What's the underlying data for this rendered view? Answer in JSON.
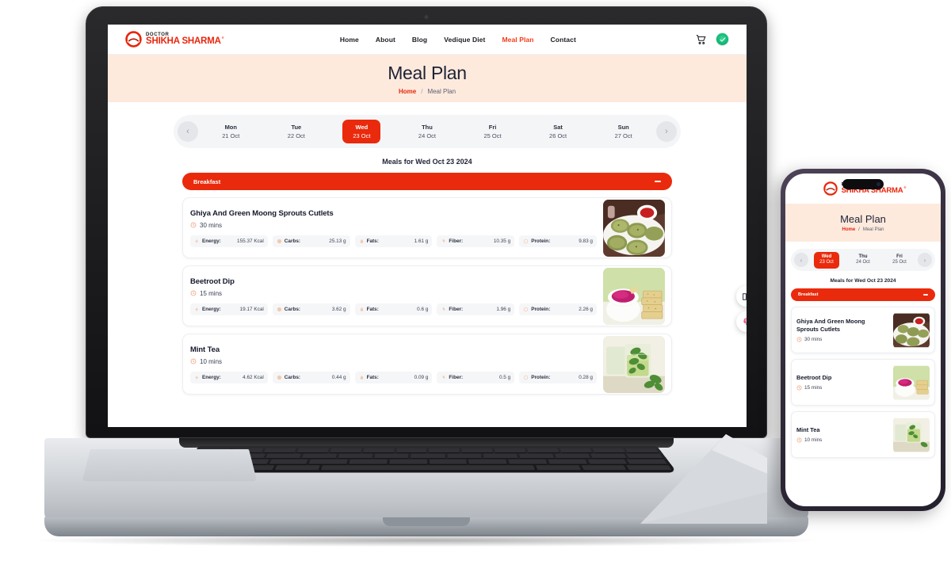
{
  "brand": {
    "doctor_label": "DOCTOR",
    "name": "SHIKHA SHARMA",
    "registered_mark": "®",
    "accent_red": "#e8260c",
    "nav_active_red": "#f63a16",
    "hero_bg": "#fdeadd",
    "accordion_red": "#ea2a0c"
  },
  "nav": {
    "items": [
      {
        "label": "Home",
        "active": false
      },
      {
        "label": "About",
        "active": false
      },
      {
        "label": "Blog",
        "active": false
      },
      {
        "label": "Vedique Diet",
        "active": false
      },
      {
        "label": "Meal Plan",
        "active": true
      },
      {
        "label": "Contact",
        "active": false
      }
    ],
    "cart_icon": "shopping-cart-icon",
    "avatar_icon": "user-avatar-verified-icon"
  },
  "hero": {
    "title": "Meal Plan",
    "breadcrumb_home": "Home",
    "breadcrumb_separator": "/",
    "breadcrumb_current": "Meal Plan"
  },
  "week_selector": {
    "prev_label": "‹",
    "next_label": "›",
    "days": [
      {
        "day": "Mon",
        "date": "21 Oct",
        "active": false
      },
      {
        "day": "Tue",
        "date": "22 Oct",
        "active": false
      },
      {
        "day": "Wed",
        "date": "23 Oct",
        "active": true
      },
      {
        "day": "Thu",
        "date": "24 Oct",
        "active": false
      },
      {
        "day": "Fri",
        "date": "25 Oct",
        "active": false
      },
      {
        "day": "Sat",
        "date": "26 Oct",
        "active": false
      },
      {
        "day": "Sun",
        "date": "27 Oct",
        "active": false
      }
    ]
  },
  "meals_heading": "Meals for Wed Oct 23 2024",
  "accordion": {
    "label": "Breakfast",
    "collapse_icon": "minus-icon",
    "expanded": true
  },
  "meals": [
    {
      "name": "Ghiya And Green Moong Sprouts Cutlets",
      "time": "30 mins",
      "image": "cutlets-with-ketchup",
      "nutrition": [
        {
          "label": "Energy:",
          "value": "155.37 Kcal",
          "icon": "energy-icon"
        },
        {
          "label": "Carbs:",
          "value": "25.13 g",
          "icon": "carbs-icon"
        },
        {
          "label": "Fats:",
          "value": "1.61 g",
          "icon": "fats-icon"
        },
        {
          "label": "Fiber:",
          "value": "10.35 g",
          "icon": "fiber-icon"
        },
        {
          "label": "Protein:",
          "value": "9.83 g",
          "icon": "protein-icon"
        }
      ]
    },
    {
      "name": "Beetroot Dip",
      "time": "15 mins",
      "image": "beetroot-dip-with-crackers",
      "nutrition": [
        {
          "label": "Energy:",
          "value": "19.17 Kcal",
          "icon": "energy-icon"
        },
        {
          "label": "Carbs:",
          "value": "3.62 g",
          "icon": "carbs-icon"
        },
        {
          "label": "Fats:",
          "value": "0.6 g",
          "icon": "fats-icon"
        },
        {
          "label": "Fiber:",
          "value": "1.96 g",
          "icon": "fiber-icon"
        },
        {
          "label": "Protein:",
          "value": "2.26 g",
          "icon": "protein-icon"
        }
      ]
    },
    {
      "name": "Mint Tea",
      "time": "10 mins",
      "image": "mint-tea-glass",
      "nutrition": [
        {
          "label": "Energy:",
          "value": "4.62 Kcal",
          "icon": "energy-icon"
        },
        {
          "label": "Carbs:",
          "value": "0.44 g",
          "icon": "carbs-icon"
        },
        {
          "label": "Fats:",
          "value": "0.09 g",
          "icon": "fats-icon"
        },
        {
          "label": "Fiber:",
          "value": "0.5 g",
          "icon": "fiber-icon"
        },
        {
          "label": "Protein:",
          "value": "0.28 g",
          "icon": "protein-icon"
        }
      ]
    }
  ],
  "floating_widgets": [
    {
      "icon": "book-reader-icon"
    },
    {
      "icon": "brain-ai-icon"
    }
  ],
  "phone": {
    "hero": {
      "title": "Meal Plan",
      "breadcrumb_home": "Home",
      "breadcrumb_separator": "/",
      "breadcrumb_current": "Meal Plan"
    },
    "week_selector": {
      "prev_label": "‹",
      "next_label": "›",
      "days": [
        {
          "day": "Wed",
          "date": "23 Oct",
          "active": true
        },
        {
          "day": "Thu",
          "date": "24 Oct",
          "active": false
        },
        {
          "day": "Fri",
          "date": "25 Oct",
          "active": false
        }
      ]
    },
    "meals_heading": "Meals for Wed Oct 23 2024",
    "accordion": {
      "label": "Breakfast",
      "collapse_icon": "minus-icon"
    },
    "meals": [
      {
        "name": "Ghiya And Green Moong Sprouts Cutlets",
        "time": "30 mins",
        "image": "cutlets-with-ketchup"
      },
      {
        "name": "Beetroot Dip",
        "time": "15 mins",
        "image": "beetroot-dip-with-crackers"
      },
      {
        "name": "Mint Tea",
        "time": "10 mins",
        "image": "mint-tea-glass"
      }
    ]
  }
}
